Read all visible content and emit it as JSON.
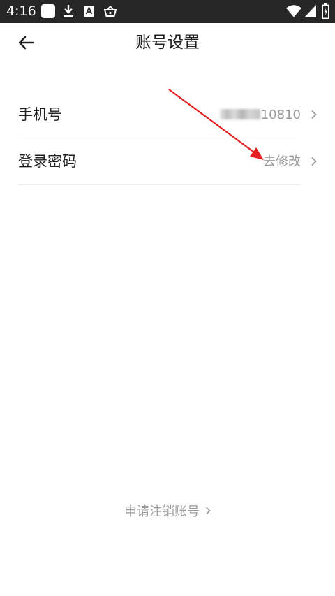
{
  "status_bar": {
    "time": "4:16",
    "left_icons": [
      "app-notification-icon",
      "download-icon",
      "keyboard-a-icon",
      "basket-icon"
    ],
    "right_icons": [
      "wifi-icon",
      "signal-icon",
      "battery-icon"
    ],
    "background": "#262626"
  },
  "header": {
    "back_icon": "arrow-left-icon",
    "title": "账号设置"
  },
  "rows": [
    {
      "label": "手机号",
      "value_suffix": "10810",
      "value_masked": true
    },
    {
      "label": "登录密码",
      "value": "去修改"
    }
  ],
  "footer": {
    "cancel_account_label": "申请注销账号"
  },
  "colors": {
    "text_primary": "#212121",
    "text_secondary": "#9a9a9a",
    "divider": "#ececec",
    "annotation_arrow": "#e52020"
  }
}
